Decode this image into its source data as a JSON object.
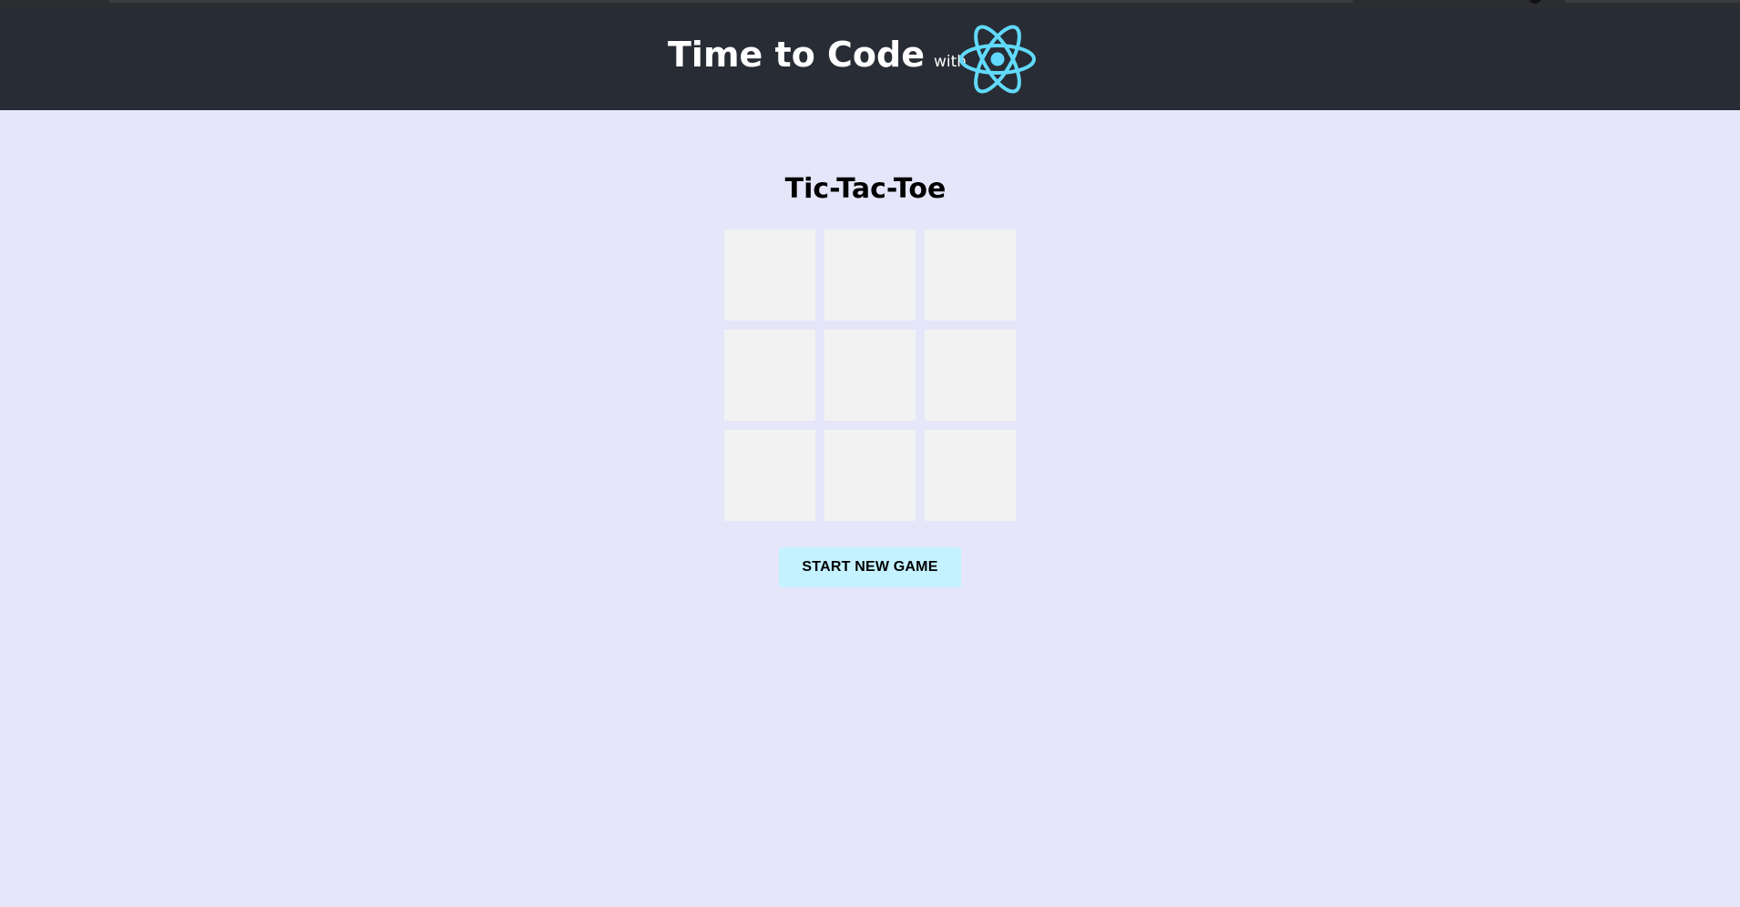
{
  "header": {
    "title": "Time to Code",
    "with_label": "with",
    "logo_icon": "react-atom-icon",
    "logo_color": "#61dafb",
    "background": "#282c34"
  },
  "game": {
    "title": "Tic-Tac-Toe",
    "cells": [
      "",
      "",
      "",
      "",
      "",
      "",
      "",
      "",
      ""
    ],
    "new_game_label": "START NEW GAME"
  },
  "colors": {
    "page_background": "#e6e6fa",
    "cell_background": "#f2f2f2",
    "button_background": "#c4f2ff"
  }
}
